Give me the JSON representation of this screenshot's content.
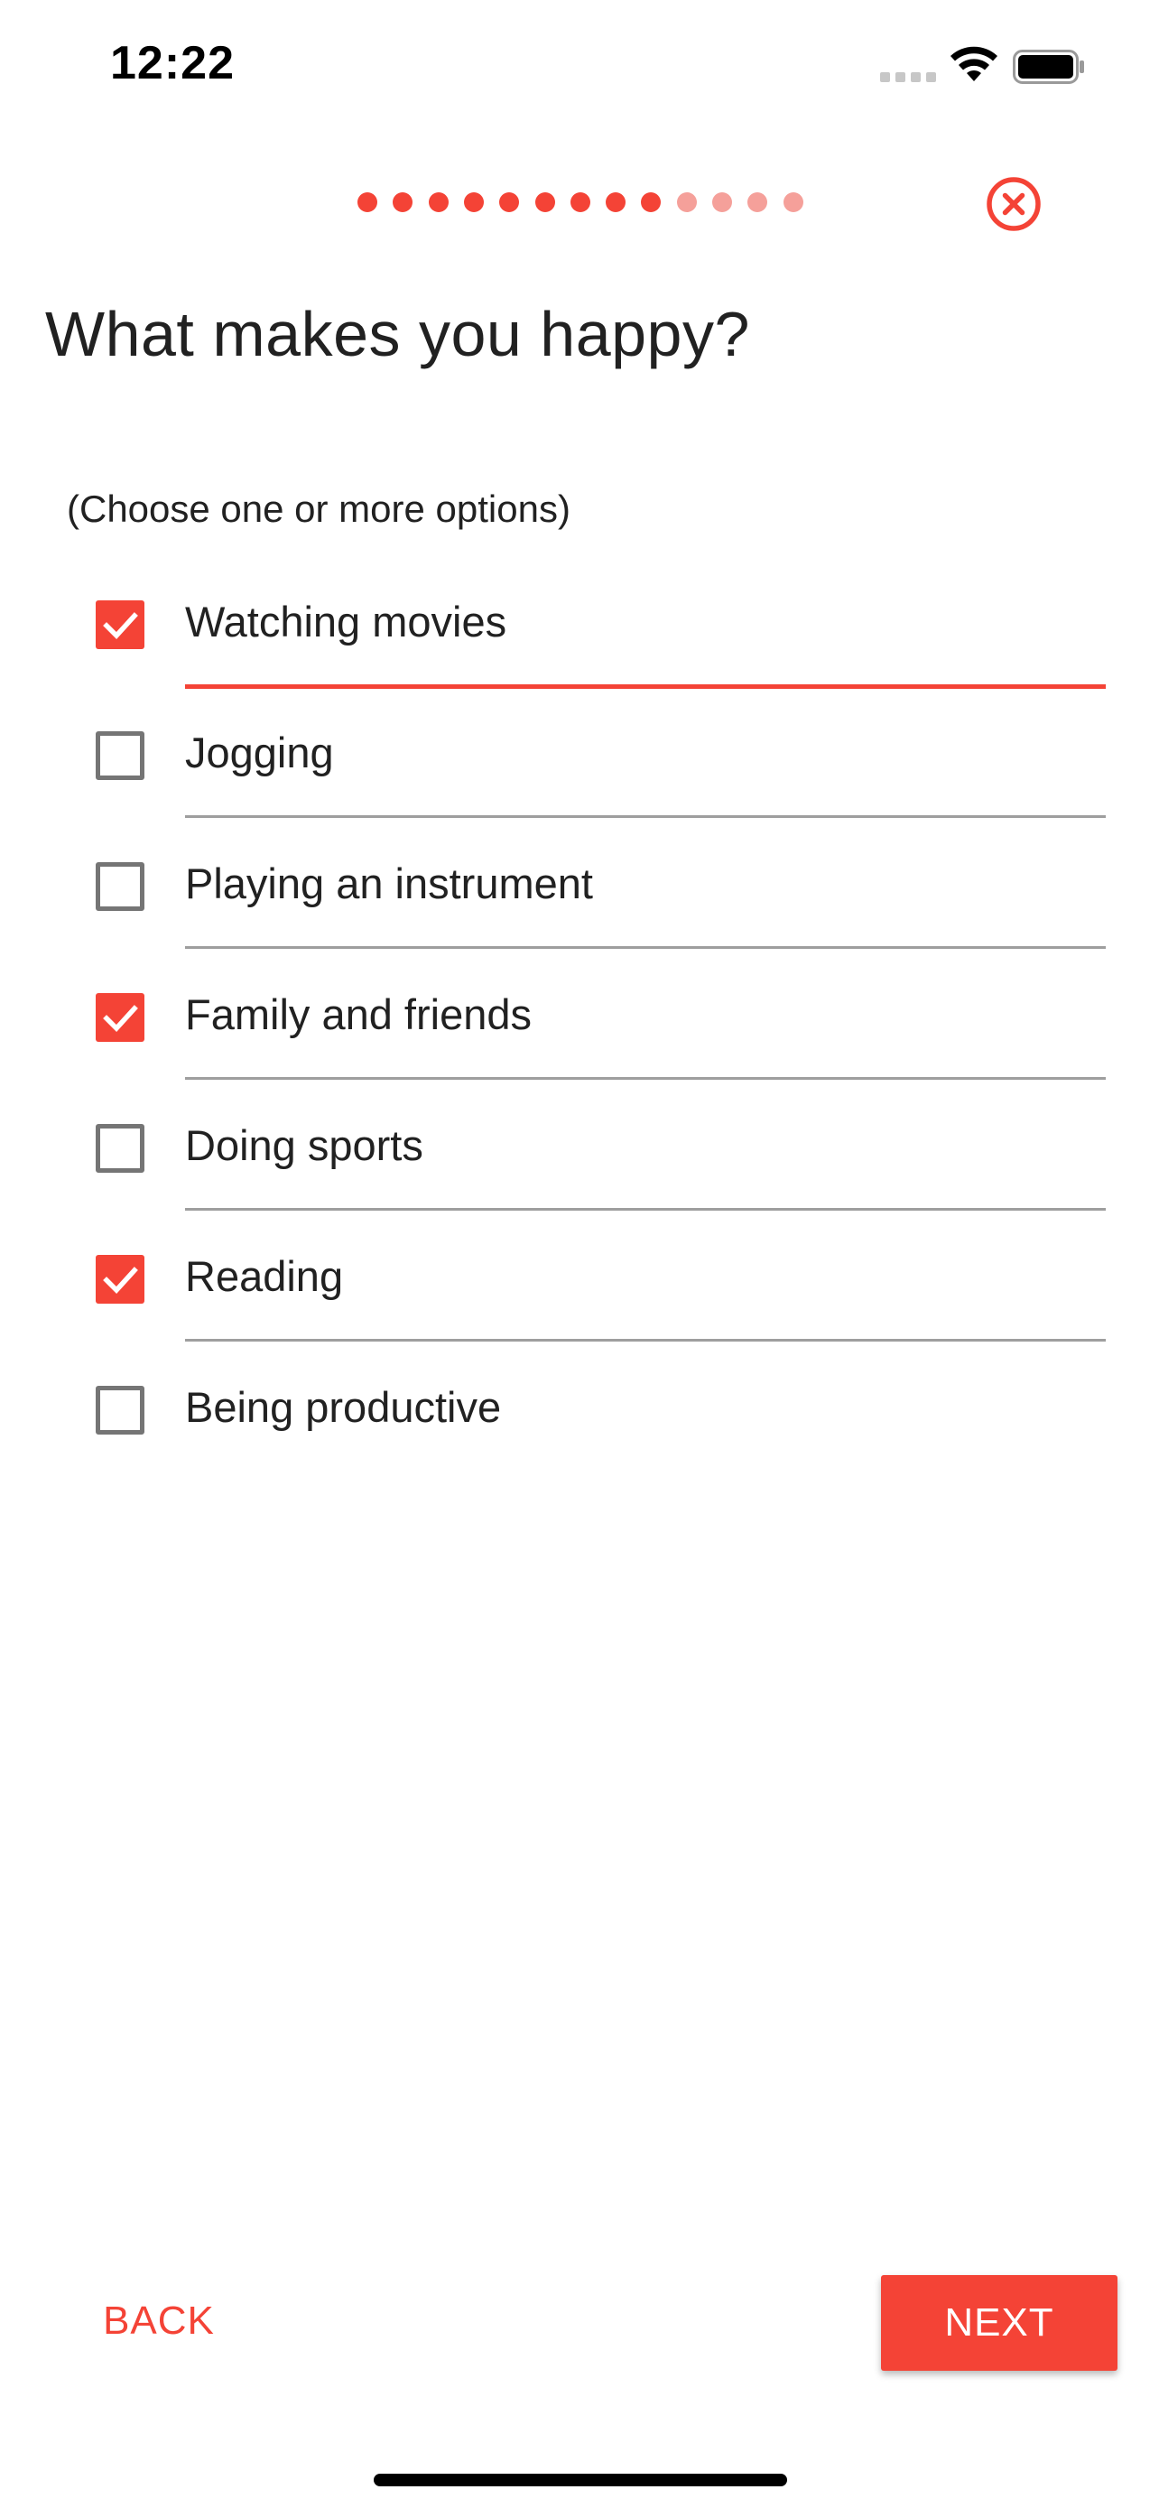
{
  "status_bar": {
    "time": "12:22",
    "signal_icon": "cellular-signal-icon",
    "wifi_icon": "wifi-icon",
    "battery_icon": "battery-full-icon"
  },
  "progress": {
    "total_steps": 13,
    "completed_steps": 9,
    "active_color": "#f44336",
    "inactive_color": "#f5a09a"
  },
  "close_icon": "close-circle-icon",
  "question": {
    "title": "What makes you happy?",
    "hint": "(Choose one or more options)"
  },
  "options": [
    {
      "label": "Watching movies",
      "checked": true
    },
    {
      "label": "Jogging",
      "checked": false
    },
    {
      "label": "Playing an instrument",
      "checked": false
    },
    {
      "label": "Family and friends",
      "checked": true
    },
    {
      "label": "Doing sports",
      "checked": false
    },
    {
      "label": "Reading",
      "checked": true
    },
    {
      "label": "Being productive",
      "checked": false
    }
  ],
  "footer": {
    "back_label": "BACK",
    "next_label": "NEXT"
  },
  "colors": {
    "accent": "#f44336",
    "divider": "#9e9e9e",
    "text": "#212121"
  }
}
